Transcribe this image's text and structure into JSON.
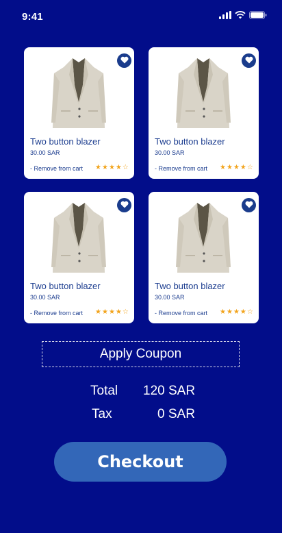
{
  "status": {
    "time": "9:41"
  },
  "colors": {
    "background": "#020d8a",
    "card": "#ffffff",
    "text": "#1c3d8f",
    "star": "#f2a41d",
    "button": "#3367b8"
  },
  "products": [
    {
      "name": "Two button blazer",
      "price": "30.00 SAR",
      "remove_label": "- Remove from cart",
      "rating": 4,
      "max_rating": 5,
      "favorite_icon": "heart-icon"
    },
    {
      "name": "Two button blazer",
      "price": "30.00 SAR",
      "remove_label": "- Remove from cart",
      "rating": 4,
      "max_rating": 5,
      "favorite_icon": "heart-icon"
    },
    {
      "name": "Two button blazer",
      "price": "30.00 SAR",
      "remove_label": "- Remove from cart",
      "rating": 4,
      "max_rating": 5,
      "favorite_icon": "heart-icon"
    },
    {
      "name": "Two button blazer",
      "price": "30.00 SAR",
      "remove_label": "- Remove from cart",
      "rating": 4,
      "max_rating": 5,
      "favorite_icon": "heart-icon"
    }
  ],
  "coupon": {
    "label": "Apply Coupon"
  },
  "summary": {
    "total_label": "Total",
    "total_value": "120 SAR",
    "tax_label": "Tax",
    "tax_value": "0 SAR"
  },
  "checkout": {
    "label": "Checkout"
  }
}
